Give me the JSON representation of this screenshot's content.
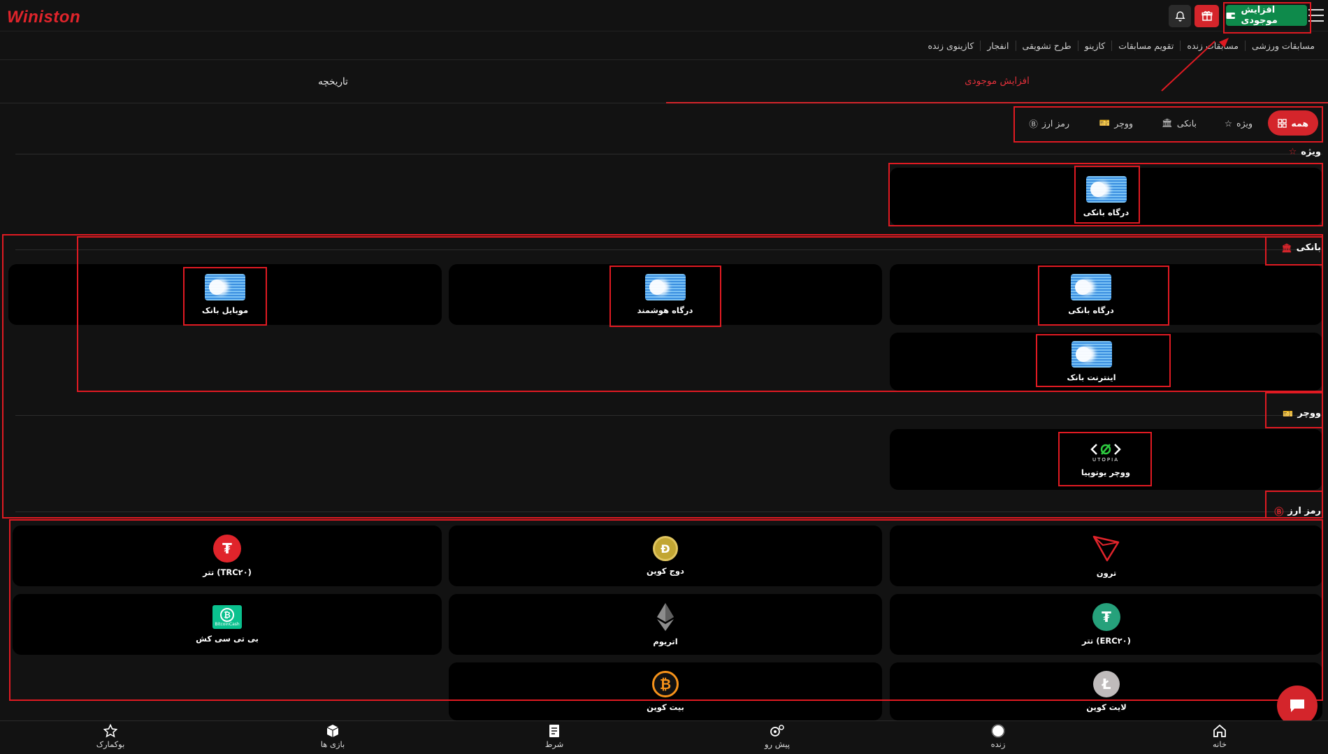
{
  "header": {
    "logo": "Winiston",
    "deposit_label": "افزایش موجودی",
    "icons": [
      "menu-icon",
      "wallet-icon",
      "gift-icon",
      "bell-icon"
    ]
  },
  "nav": {
    "items": [
      "مسابقات ورزشی",
      "مسابقات زنده",
      "تقویم مسابقات",
      "کازینو",
      "طرح تشویقی",
      "انفجار",
      "کازینوی زنده"
    ]
  },
  "tabs": {
    "deposit": "افزایش موجودی",
    "history": "تاریخچه"
  },
  "filters": {
    "all": "همه",
    "special": "ویژه",
    "bank": "بانکی",
    "voucher": "ووچر",
    "crypto": "رمز ارز"
  },
  "sections": {
    "special": {
      "title": "ویژه",
      "items": [
        "درگاه بانکی"
      ]
    },
    "bank": {
      "title": "بانکی",
      "items": [
        "درگاه بانکی",
        "درگاه هوشمند",
        "موبایل بانک",
        "اینترنت بانک"
      ]
    },
    "voucher": {
      "title": "ووچر",
      "items": [
        "ووچر یوتوپیا"
      ],
      "logo_text": "UTOPIA"
    },
    "crypto": {
      "title": "رمز ارز",
      "items": [
        "ترون",
        "دوج کوین",
        "تتر (TRC۲۰)",
        "تتر (ERC۲۰)",
        "اتریوم",
        "بی تی سی کش",
        "لایت کوین",
        "بیت کوین"
      ],
      "bch_logo_text": "BitcoinCash"
    }
  },
  "bottom_nav": {
    "items": [
      "خانه",
      "زنده",
      "پیش رو",
      "شرط",
      "بازی ها",
      "بوکمارک"
    ]
  },
  "colors": {
    "accent_red": "#d4252b",
    "deposit_green": "#0e8a4b",
    "annotation_red": "#e01a22"
  }
}
